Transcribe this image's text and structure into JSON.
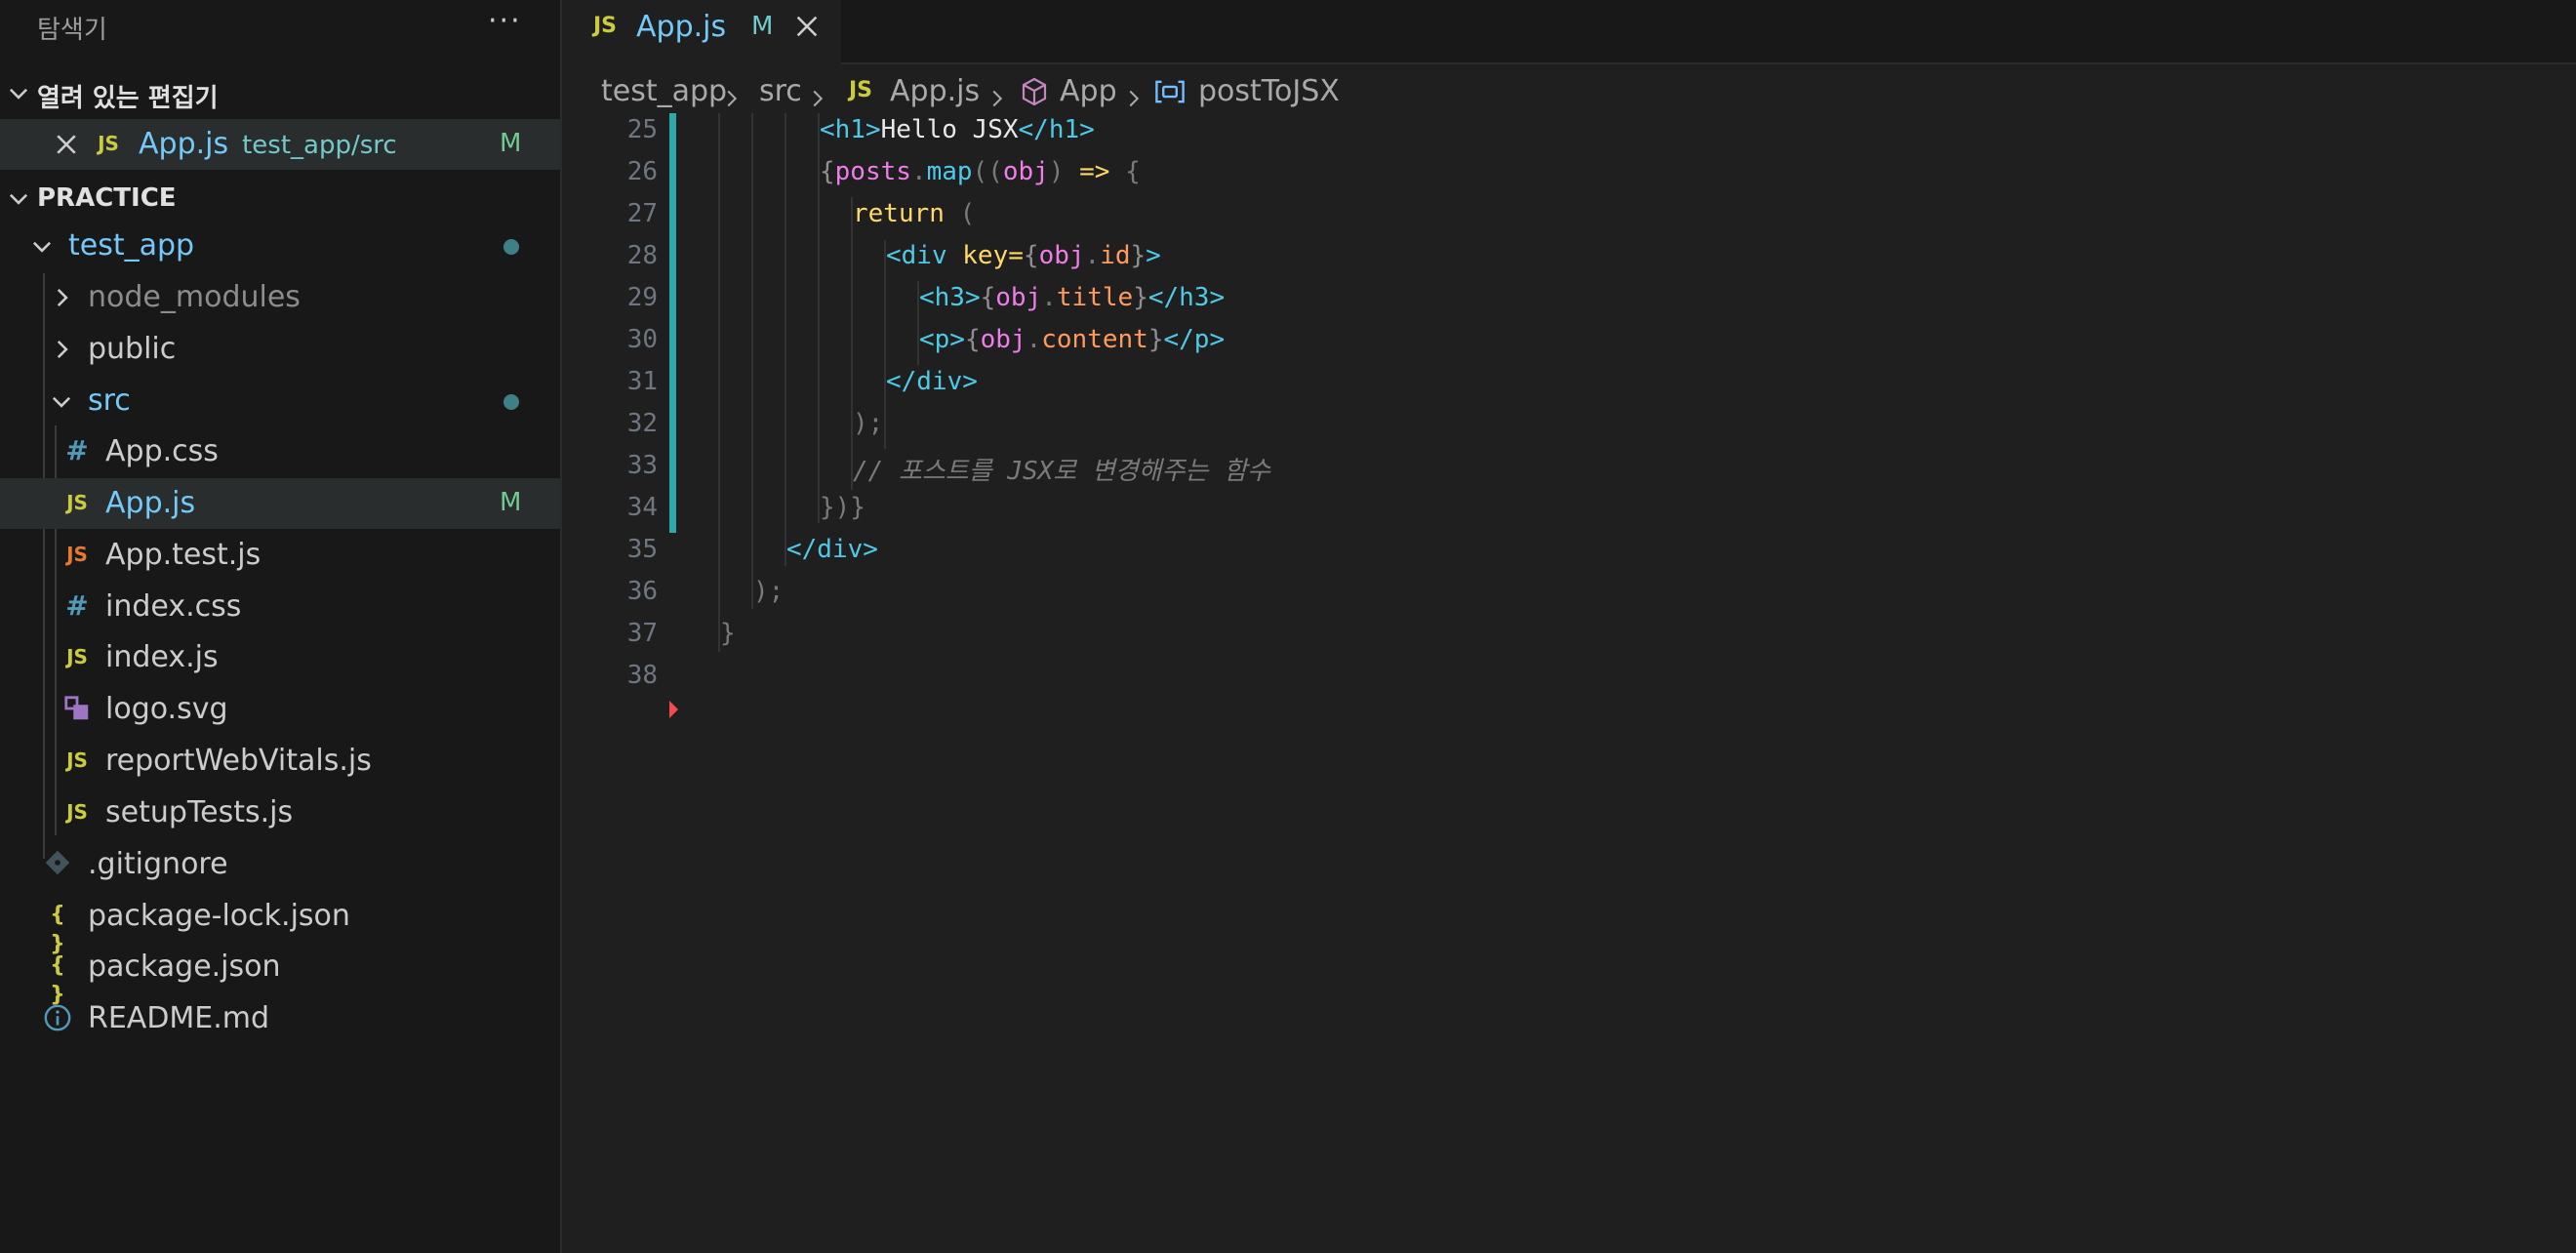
{
  "sidebar": {
    "title": "탐색기",
    "more": "···",
    "open_editors": {
      "label": "열려 있는 편집기",
      "items": [
        {
          "name": "App.js",
          "path": "test_app/src",
          "badge": "M",
          "icon": "JS"
        }
      ]
    },
    "workspace": {
      "label": "PRACTICE",
      "items": [
        {
          "name": "test_app",
          "type": "folder",
          "open": true,
          "dot": true
        },
        {
          "name": "node_modules",
          "type": "folder",
          "open": false
        },
        {
          "name": "public",
          "type": "folder",
          "open": false
        },
        {
          "name": "src",
          "type": "folder",
          "open": true,
          "dot": true
        },
        {
          "name": "App.css",
          "icon": "#"
        },
        {
          "name": "App.js",
          "icon": "JS",
          "badge": "M",
          "selected": true
        },
        {
          "name": "App.test.js",
          "icon": "JS"
        },
        {
          "name": "index.css",
          "icon": "#"
        },
        {
          "name": "index.js",
          "icon": "JS"
        },
        {
          "name": "logo.svg",
          "icon": "svg-icon"
        },
        {
          "name": "reportWebVitals.js",
          "icon": "JS"
        },
        {
          "name": "setupTests.js",
          "icon": "JS"
        },
        {
          "name": ".gitignore",
          "icon": "git-icon"
        },
        {
          "name": "package-lock.json",
          "icon": "{ }"
        },
        {
          "name": "package.json",
          "icon": "{ }"
        },
        {
          "name": "README.md",
          "icon": "info-icon"
        }
      ]
    }
  },
  "tab": {
    "icon": "JS",
    "name": "App.js",
    "badge": "M"
  },
  "breadcrumb": {
    "folder": "test_app",
    "sub": "src",
    "file_icon": "JS",
    "file": "App.js",
    "component": "App",
    "symbol": "postToJSX"
  },
  "code": {
    "line_numbers": [
      "25",
      "26",
      "27",
      "28",
      "29",
      "30",
      "31",
      "32",
      "33",
      "34",
      "35",
      "36",
      "37",
      "38"
    ]
  },
  "colors": {
    "accent": "#2ea9a9",
    "js_icon": "#cbcb41",
    "css_icon": "#519aba",
    "modified": "#73c991"
  }
}
